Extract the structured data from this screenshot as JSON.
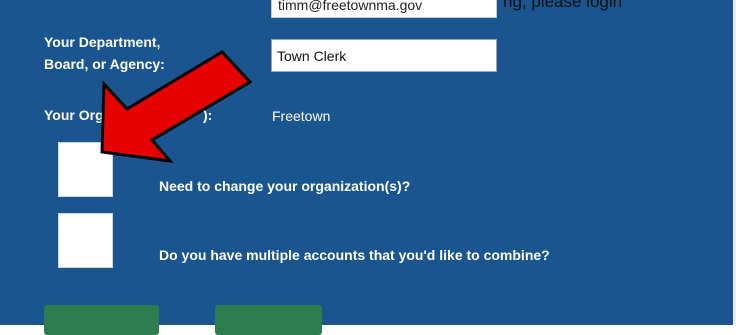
{
  "form": {
    "email_value": "timm@freetownma.gov",
    "top_right_text": "ng, please login",
    "department_label_line1": "Your Department,",
    "department_label_line2": "Board, or Agency:",
    "department_value": "Town Clerk",
    "organization_label_start": "Your Org",
    "organization_label_end": "):",
    "organization_value": "Freetown",
    "change_org_question": "Need to change your organization(s)?",
    "combine_accounts_question": "Do you have multiple accounts that you'd like to combine?"
  },
  "annotation": {
    "arrow_color": "#e60000",
    "arrow_icon": "red-arrow-icon"
  },
  "colors": {
    "panel_bg": "#1b5590",
    "button_bg": "#2e7d4f"
  }
}
